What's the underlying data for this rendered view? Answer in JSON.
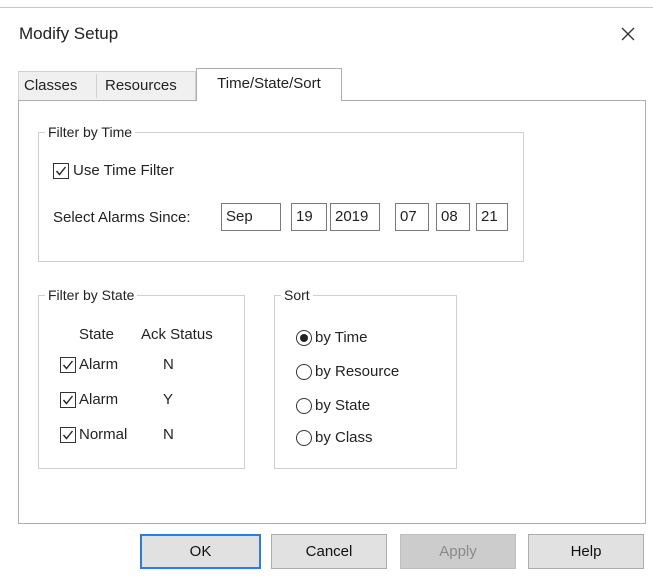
{
  "window": {
    "title": "Modify Setup"
  },
  "tabs": [
    {
      "label": "Classes",
      "active": false
    },
    {
      "label": "Resources",
      "active": false
    },
    {
      "label": "Time/State/Sort",
      "active": true
    }
  ],
  "filter_time": {
    "group_label": "Filter by Time",
    "use_time_filter_label": "Use Time Filter",
    "use_time_filter_checked": true,
    "since_label": "Select Alarms Since:",
    "month": "Sep",
    "day": "19",
    "year": "2019",
    "hour": "07",
    "minute": "08",
    "second": "21"
  },
  "filter_state": {
    "group_label": "Filter by State",
    "header_state": "State",
    "header_ack": "Ack Status",
    "rows": [
      {
        "state": "Alarm",
        "ack": "N",
        "checked": true
      },
      {
        "state": "Alarm",
        "ack": "Y",
        "checked": true
      },
      {
        "state": "Normal",
        "ack": "N",
        "checked": true
      }
    ]
  },
  "sort": {
    "group_label": "Sort",
    "options": [
      {
        "label": "by Time",
        "selected": true
      },
      {
        "label": "by Resource",
        "selected": false
      },
      {
        "label": "by State",
        "selected": false
      },
      {
        "label": "by Class",
        "selected": false
      }
    ]
  },
  "buttons": {
    "ok": "OK",
    "cancel": "Cancel",
    "apply": "Apply",
    "help": "Help"
  },
  "colors": {
    "default_button_border": "#2c7de0",
    "disabled_button_bg": "#cccccc"
  }
}
